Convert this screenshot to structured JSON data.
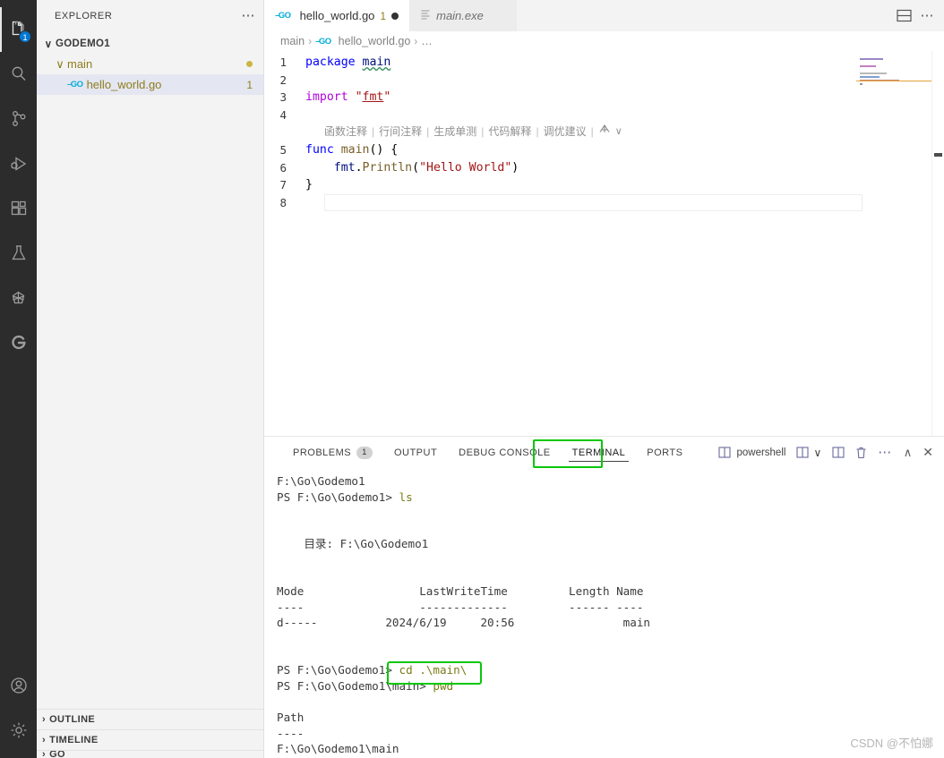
{
  "activitybar": {
    "items": [
      {
        "name": "explorer",
        "icon": "files-icon",
        "badge": "1",
        "active": true
      },
      {
        "name": "search",
        "icon": "search-icon",
        "badge": "",
        "active": false
      },
      {
        "name": "source-control",
        "icon": "source-control-icon",
        "badge": "",
        "active": false
      },
      {
        "name": "run-and-debug",
        "icon": "run-debug-icon",
        "badge": "",
        "active": false
      },
      {
        "name": "extensions",
        "icon": "extensions-icon",
        "badge": "",
        "active": false
      },
      {
        "name": "testing",
        "icon": "beaker-icon",
        "badge": "",
        "active": false
      },
      {
        "name": "remote-explorer",
        "icon": "origami-icon",
        "badge": "",
        "active": false
      },
      {
        "name": "copilot",
        "icon": "circle-c-icon",
        "badge": "",
        "active": false
      }
    ],
    "bottom": [
      {
        "name": "accounts",
        "icon": "account-icon"
      },
      {
        "name": "manage",
        "icon": "gear-icon"
      }
    ]
  },
  "sidebar": {
    "title": "EXPLORER",
    "more_actions": "⋯",
    "tree": {
      "root": {
        "label": "GODEMO1",
        "chevron": "∨"
      },
      "folder": {
        "label": "main",
        "chevron": "∨",
        "marker": "modified-dot"
      },
      "file": {
        "label": "hello_world.go",
        "icon": "go-file-icon",
        "count": "1"
      }
    },
    "sections": [
      {
        "label": "OUTLINE",
        "chevron": "›"
      },
      {
        "label": "TIMELINE",
        "chevron": "›"
      },
      {
        "label": "GO",
        "chevron": "›"
      }
    ]
  },
  "tabs": [
    {
      "label": "hello_world.go",
      "icon": "go-file-icon",
      "count": "1",
      "dirty": true,
      "active": true
    },
    {
      "label": "main.exe",
      "icon": "binary-file-icon",
      "count": "",
      "dirty": false,
      "active": false
    }
  ],
  "editor_actions": [
    {
      "name": "toggle-panel-layout-icon"
    },
    {
      "name": "more-actions-icon",
      "glyph": "⋯"
    }
  ],
  "breadcrumb": {
    "items": [
      {
        "label": "main",
        "icon": ""
      },
      {
        "label": "hello_world.go",
        "icon": "go-file-icon"
      },
      {
        "label": "…",
        "icon": ""
      }
    ],
    "separator": "›"
  },
  "code": {
    "lines": [
      {
        "num": "1",
        "tokens": [
          {
            "t": "package ",
            "c": "kw"
          },
          {
            "t": "main",
            "c": "ident squiggle"
          }
        ]
      },
      {
        "num": "2",
        "tokens": []
      },
      {
        "num": "3",
        "tokens": [
          {
            "t": "import ",
            "c": "kw2"
          },
          {
            "t": "\"",
            "c": "str"
          },
          {
            "t": "fmt",
            "c": "strlink"
          },
          {
            "t": "\"",
            "c": "str"
          }
        ]
      },
      {
        "num": "4",
        "tokens": []
      },
      {
        "num": "5",
        "tokens": [
          {
            "t": "func ",
            "c": "kw"
          },
          {
            "t": "main",
            "c": "fn"
          },
          {
            "t": "() {",
            "c": "plain"
          }
        ]
      },
      {
        "num": "6",
        "tokens": [
          {
            "t": "    fmt",
            "c": "ident"
          },
          {
            "t": ".",
            "c": "plain"
          },
          {
            "t": "Println",
            "c": "fn"
          },
          {
            "t": "(",
            "c": "plain"
          },
          {
            "t": "\"Hello World\"",
            "c": "str"
          },
          {
            "t": ")",
            "c": "plain"
          }
        ]
      },
      {
        "num": "7",
        "tokens": [
          {
            "t": "}",
            "c": "plain"
          }
        ]
      },
      {
        "num": "8",
        "tokens": []
      }
    ],
    "codelens": {
      "items": [
        "函数注释",
        "行间注释",
        "生成单测",
        "代码解释",
        "调优建议"
      ],
      "separator": "|",
      "trailing_icon": "ai-assistant-icon",
      "chevron": "∨"
    }
  },
  "panel": {
    "tabs": [
      {
        "label": "PROBLEMS",
        "badge": "1",
        "active": false
      },
      {
        "label": "OUTPUT",
        "badge": "",
        "active": false
      },
      {
        "label": "DEBUG CONSOLE",
        "badge": "",
        "active": false
      },
      {
        "label": "TERMINAL",
        "badge": "",
        "active": true
      },
      {
        "label": "PORTS",
        "badge": "",
        "active": false
      }
    ],
    "terminal_name": "powershell",
    "actions": [
      {
        "name": "split-terminal-icon"
      },
      {
        "name": "chevron-down-icon",
        "glyph": "∨"
      },
      {
        "name": "new-terminal-icon"
      },
      {
        "name": "kill-terminal-icon"
      },
      {
        "name": "terminal-more-icon",
        "glyph": "⋯"
      },
      {
        "name": "maximize-panel-icon",
        "glyph": "∧"
      },
      {
        "name": "close-panel-icon",
        "glyph": "✕"
      }
    ]
  },
  "terminal_output": [
    {
      "text": "F:\\Go\\Godemo1",
      "cmd": ""
    },
    {
      "text": "PS F:\\Go\\Godemo1> ",
      "cmd": "ls"
    },
    {
      "text": "",
      "cmd": ""
    },
    {
      "text": "",
      "cmd": ""
    },
    {
      "text": "    目录: F:\\Go\\Godemo1",
      "cmd": ""
    },
    {
      "text": "",
      "cmd": ""
    },
    {
      "text": "",
      "cmd": ""
    },
    {
      "text": "Mode                 LastWriteTime         Length Name",
      "cmd": ""
    },
    {
      "text": "----                 -------------         ------ ----",
      "cmd": ""
    },
    {
      "text": "d-----          2024/6/19     20:56                main",
      "cmd": ""
    },
    {
      "text": "",
      "cmd": ""
    },
    {
      "text": "",
      "cmd": ""
    },
    {
      "text": "PS F:\\Go\\Godemo1> ",
      "cmd": "cd .\\main\\"
    },
    {
      "text": "PS F:\\Go\\Godemo1\\main> ",
      "cmd": "pwd"
    },
    {
      "text": "",
      "cmd": ""
    },
    {
      "text": "Path",
      "cmd": ""
    },
    {
      "text": "----",
      "cmd": ""
    },
    {
      "text": "F:\\Go\\Godemo1\\main",
      "cmd": ""
    }
  ],
  "highlights": {
    "accent_green": "#0ac70a",
    "terminal_tab_box": "TERMINAL",
    "command_box": "cd .\\main\\"
  },
  "watermark": "CSDN @不怕娜"
}
